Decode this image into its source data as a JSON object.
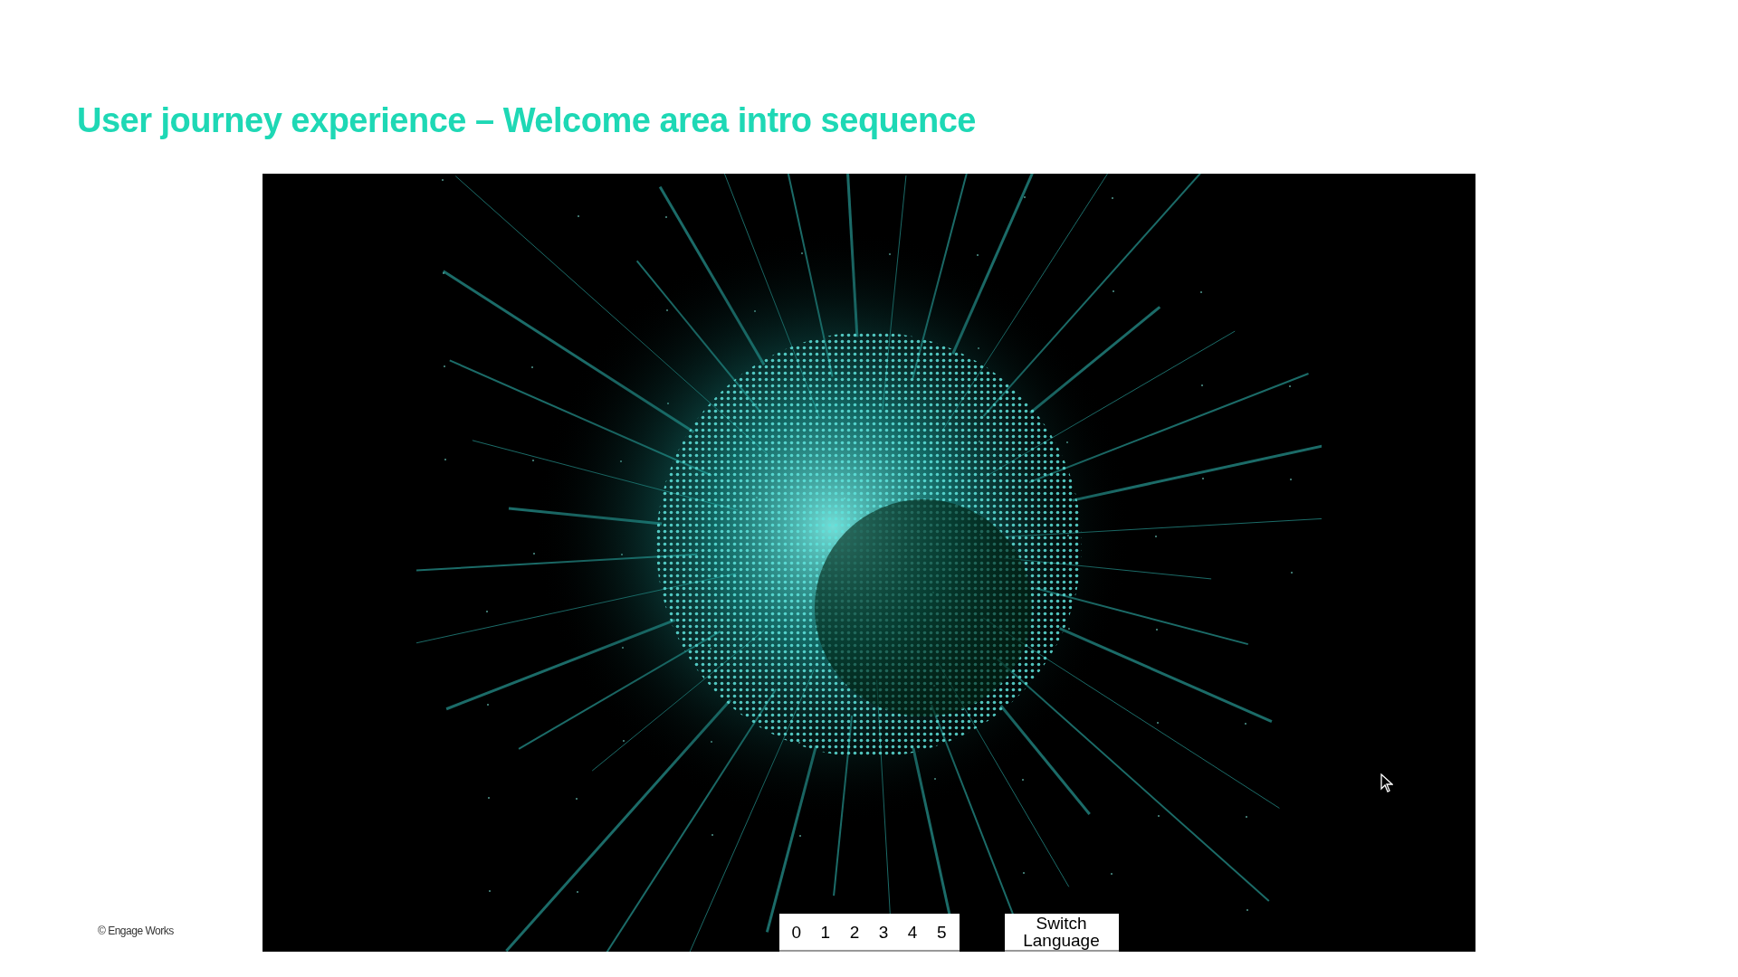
{
  "title": "User journey experience – Welcome area intro sequence",
  "screen": {
    "scene_buttons": [
      "0",
      "1",
      "2",
      "3",
      "4",
      "5"
    ],
    "switch_button": "Switch Language"
  },
  "footer": {
    "copyright": "© Engage Works"
  }
}
